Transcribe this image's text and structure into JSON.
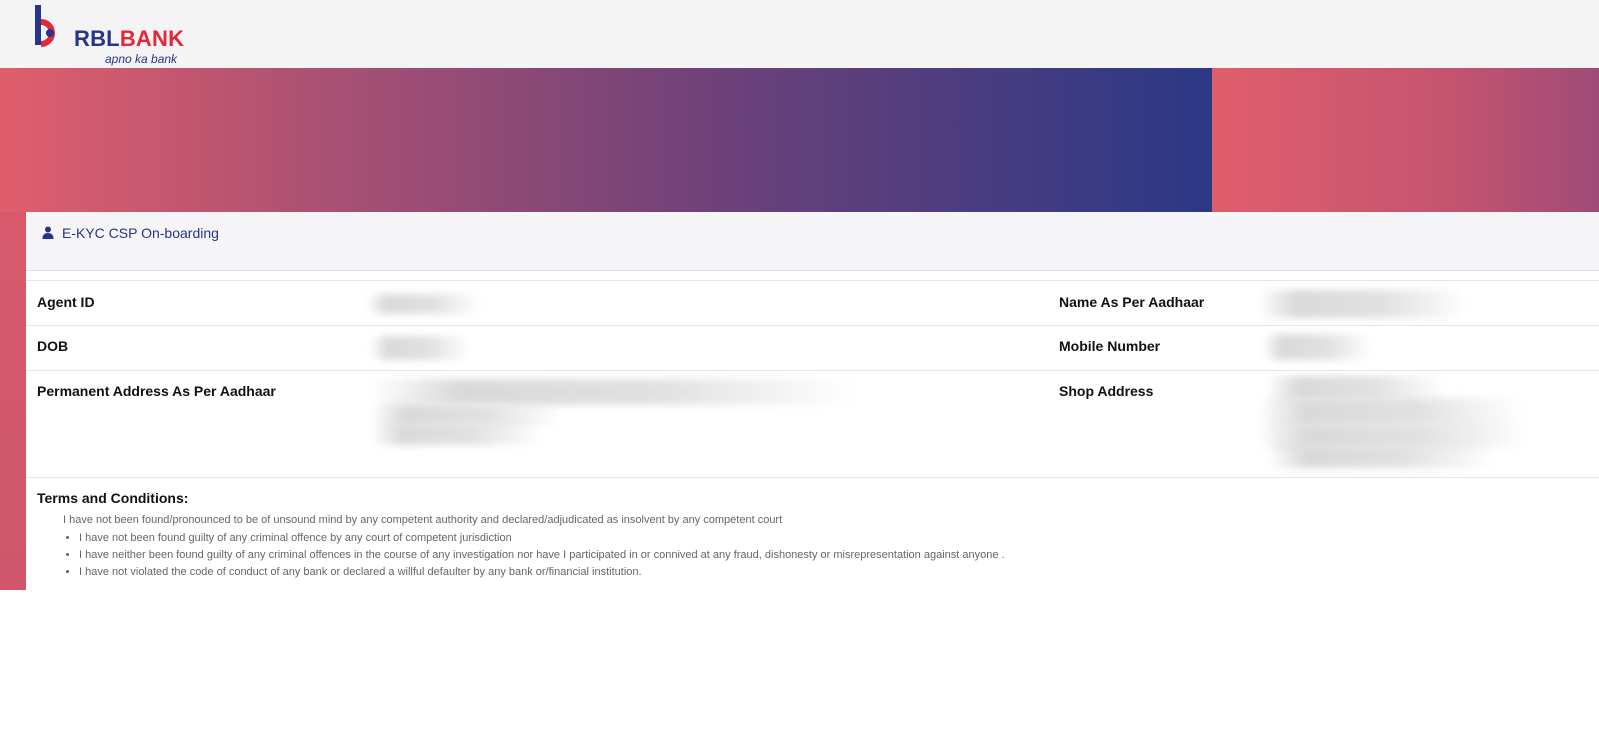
{
  "brand": {
    "name_part1": "RBL",
    "name_part2": "BANK",
    "tagline": "apno ka bank",
    "colors": {
      "blue": "#27348b",
      "red": "#e1293b"
    }
  },
  "card": {
    "icon": "user-icon",
    "title": "E-KYC CSP On-boarding"
  },
  "fields": {
    "agent_id_label": "Agent ID",
    "name_label": "Name As Per Aadhaar",
    "dob_label": "DOB",
    "mobile_label": "Mobile Number",
    "permanent_address_label": "Permanent Address As Per Aadhaar",
    "shop_address_label": "Shop Address"
  },
  "terms": {
    "heading": "Terms and Conditions:",
    "intro": "I have not been found/pronounced to be of unsound mind by any competent authority and declared/adjudicated as insolvent by any competent court",
    "items": [
      "I have not been found guilty of any criminal offence by any court of competent jurisdiction",
      "I have neither been found guilty of any criminal offences in the course of any investigation nor have I participated in or connived at any fraud, dishonesty or misrepresentation against anyone .",
      "I have not violated the code of conduct of any bank or declared a willful defaulter by any bank or/financial institution."
    ]
  }
}
